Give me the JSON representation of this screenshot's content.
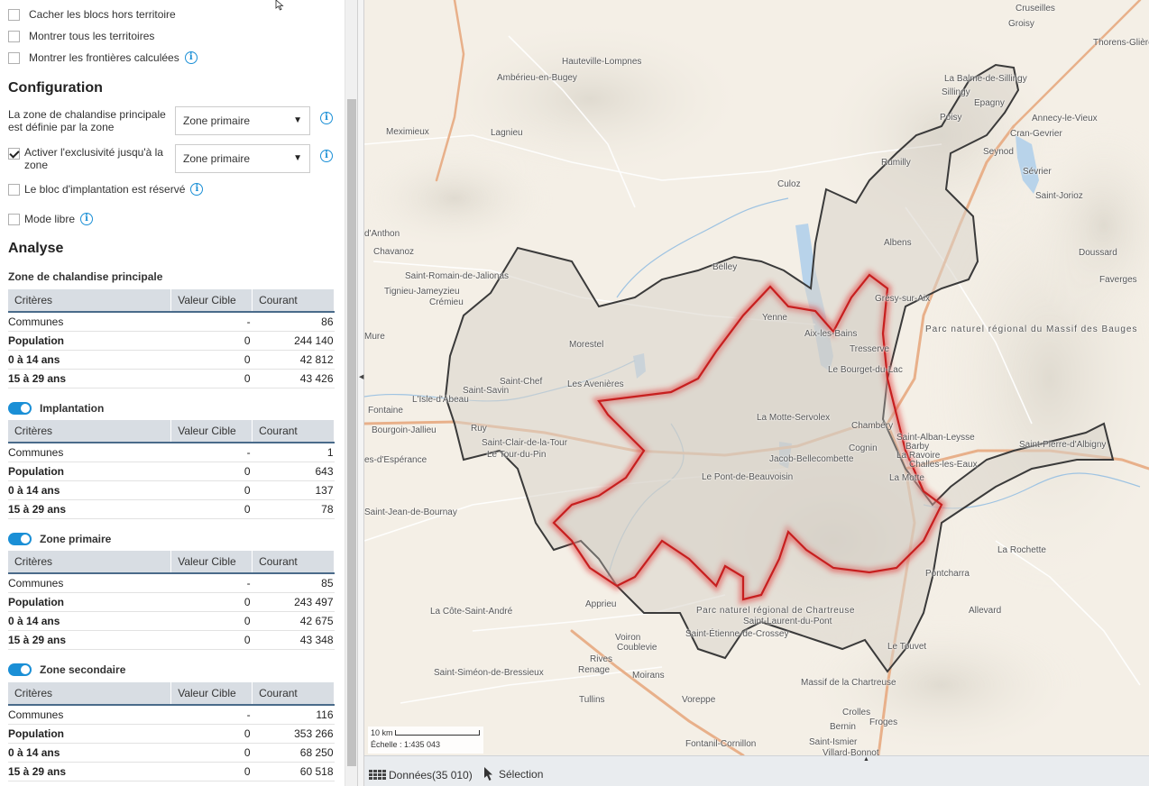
{
  "options": {
    "hide_blocks": "Cacher les blocs hors territoire",
    "show_territories": "Montrer tous les territoires",
    "show_borders": "Montrer les frontières calculées"
  },
  "configuration": {
    "title": "Configuration",
    "zone_label": "La zone de chalandise principale est définie par la zone",
    "zone_select": "Zone primaire",
    "exclusivity_label": "Activer l'exclusivité jusqu'à la zone",
    "exclusivity_checked": true,
    "exclusivity_select": "Zone primaire",
    "reserved_label": "Le bloc d'implantation est réservé",
    "free_mode_label": "Mode libre"
  },
  "analyse": {
    "title": "Analyse",
    "main_zone_title": "Zone de chalandise principale",
    "headers": [
      "Critères",
      "Valeur Cible",
      "Courant"
    ],
    "tables": [
      {
        "name": "",
        "rows": [
          {
            "label": "Communes",
            "target": "-",
            "current": "86"
          },
          {
            "label": "Population",
            "target": "0",
            "current": "244 140"
          },
          {
            "label": "0 à 14 ans",
            "target": "0",
            "current": "42 812"
          },
          {
            "label": "15 à 29 ans",
            "target": "0",
            "current": "43 426"
          }
        ]
      },
      {
        "name": "Implantation",
        "rows": [
          {
            "label": "Communes",
            "target": "-",
            "current": "1"
          },
          {
            "label": "Population",
            "target": "0",
            "current": "643"
          },
          {
            "label": "0 à 14 ans",
            "target": "0",
            "current": "137"
          },
          {
            "label": "15 à 29 ans",
            "target": "0",
            "current": "78"
          }
        ]
      },
      {
        "name": "Zone primaire",
        "rows": [
          {
            "label": "Communes",
            "target": "-",
            "current": "85"
          },
          {
            "label": "Population",
            "target": "0",
            "current": "243 497"
          },
          {
            "label": "0 à 14 ans",
            "target": "0",
            "current": "42 675"
          },
          {
            "label": "15 à 29 ans",
            "target": "0",
            "current": "43 348"
          }
        ]
      },
      {
        "name": "Zone secondaire",
        "rows": [
          {
            "label": "Communes",
            "target": "-",
            "current": "116"
          },
          {
            "label": "Population",
            "target": "0",
            "current": "353 266"
          },
          {
            "label": "0 à 14 ans",
            "target": "0",
            "current": "68 250"
          },
          {
            "label": "15 à 29 ans",
            "target": "0",
            "current": "60 518"
          }
        ]
      }
    ]
  },
  "map": {
    "places": [
      "Cruseilles",
      "Groisy",
      "Thorens-Glières",
      "Hauteville-Lompnes",
      "Ambérieu-en-Bugey",
      "La Balme-de-Sillingy",
      "Sillingy",
      "Epagny",
      "Poisy",
      "Annecy-le-Vieux",
      "Cran-Gevrier",
      "Meximieux",
      "Lagnieu",
      "Seynod",
      "Sévrier",
      "Rumilly",
      "Culoz",
      "Saint-Jorioz",
      "d'Anthon",
      "Chavanoz",
      "Albens",
      "Doussard",
      "Belley",
      "Saint-Romain-de-Jalionas",
      "Faverges",
      "Tignieu-Jameyzieu",
      "Crémieu",
      "Grésy-sur-Aix",
      "Yenne",
      "Aix-les-Bains",
      "Parc naturel régional du Massif des Bauges",
      "Morestel",
      "Tresserve",
      "Mure",
      "Le Bourget-du-Lac",
      "Saint-Chef",
      "Les Avenières",
      "Saint-Savin",
      "L'Isle-d'Abeau",
      "Fontaine",
      "La Motte-Servolex",
      "Chambéry",
      "Bourgoin-Jallieu",
      "Ruy",
      "Saint-Alban-Leysse",
      "Barby",
      "Saint-Clair-de-la-Tour",
      "Le Tour-du-Pin",
      "Cognin",
      "La Ravoire",
      "Saint-Pierre-d'Albigny",
      "Jacob-Bellecombette",
      "Challes-les-Eaux",
      "es-d'Espérance",
      "Le Pont-de-Beauvoisin",
      "La Motte",
      "Saint-Jean-de-Bournay",
      "La Rochette",
      "Pontcharra",
      "Apprieu",
      "Parc naturel régional de Chartreuse",
      "La Côte-Saint-André",
      "Saint-Laurent-du-Pont",
      "Allevard",
      "Saint-Étienne-de-Crossey",
      "Voiron",
      "Coublevie",
      "Le Touvet",
      "Rives",
      "Renage",
      "Moirans",
      "Saint-Siméon-de-Bressieux",
      "Massif de la Chartreuse",
      "Tullins",
      "Voreppe",
      "Crolles",
      "Froges",
      "Bernin",
      "Fontanil-Cornillon",
      "Saint-Ismier",
      "Villard-Bonnot"
    ],
    "scale_label": "10 km",
    "scale_ratio": "Échelle : 1:435 043"
  },
  "bottombar": {
    "data_label": "Données(35 010)",
    "selection_label": "Sélection"
  }
}
